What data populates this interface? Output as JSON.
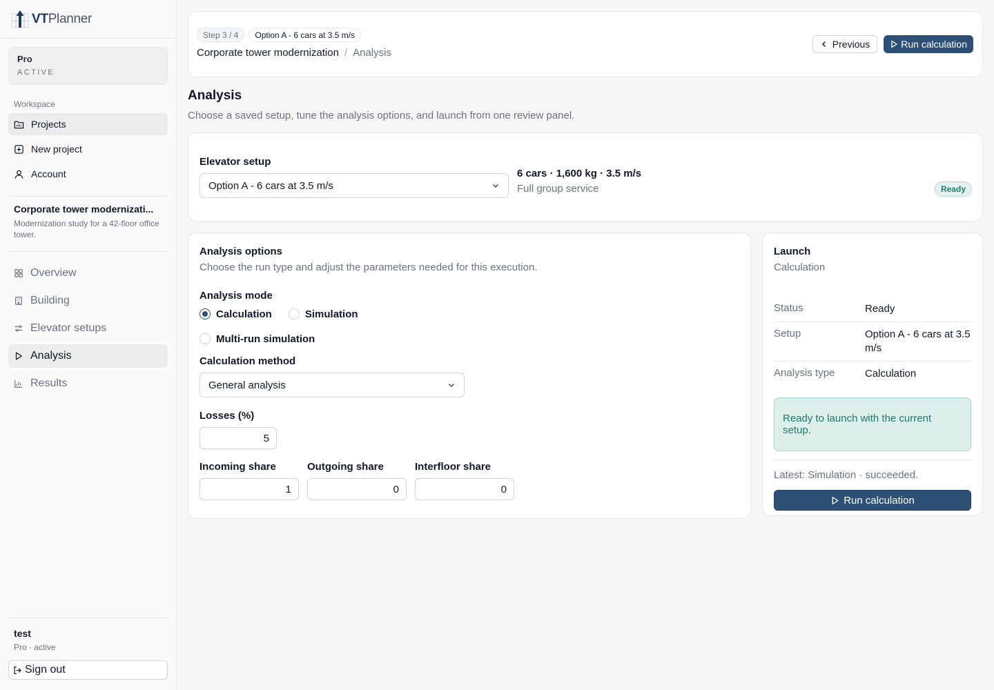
{
  "brand": {
    "vt": "VT",
    "planner": "Planner"
  },
  "plan": {
    "name": "Pro",
    "status": "ACTIVE"
  },
  "workspace": {
    "title": "Workspace",
    "items": [
      {
        "label": "Projects",
        "icon": "folder-icon",
        "active": true
      },
      {
        "label": "New project",
        "icon": "plus-square-icon",
        "active": false
      },
      {
        "label": "Account",
        "icon": "user-icon",
        "active": false
      }
    ]
  },
  "project": {
    "title": "Corporate tower modernizati...",
    "description": "Modernization study for a 42-floor office tower.",
    "nav": [
      {
        "label": "Overview",
        "icon": "grid-icon",
        "active": false
      },
      {
        "label": "Building",
        "icon": "building-icon",
        "active": false
      },
      {
        "label": "Elevator setups",
        "icon": "sliders-icon",
        "active": false
      },
      {
        "label": "Analysis",
        "icon": "play-icon",
        "active": true
      },
      {
        "label": "Results",
        "icon": "bar-chart-icon",
        "active": false
      }
    ]
  },
  "user": {
    "name": "test",
    "plan": "Pro · active",
    "signout": "Sign out"
  },
  "header": {
    "step": "Step 3 / 4",
    "option_chip": "Option A - 6 cars at 3.5 m/s",
    "breadcrumb_project": "Corporate tower modernization",
    "breadcrumb_sep": "/",
    "breadcrumb_current": "Analysis",
    "previous_label": "Previous",
    "run_label": "Run calculation"
  },
  "page": {
    "title": "Analysis",
    "subtitle": "Choose a saved setup, tune the analysis options, and launch from one review panel."
  },
  "setup": {
    "label": "Elevator setup",
    "selected": "Option A - 6 cars at 3.5 m/s",
    "spec": "6 cars · 1,600 kg · 3.5 m/s",
    "service": "Full group service",
    "badge": "Ready"
  },
  "options": {
    "title": "Analysis options",
    "subtitle": "Choose the run type and adjust the parameters needed for this execution.",
    "mode_label": "Analysis mode",
    "modes": [
      {
        "label": "Calculation",
        "selected": true
      },
      {
        "label": "Simulation",
        "selected": false
      },
      {
        "label": "Multi-run simulation",
        "selected": false
      }
    ],
    "method_label": "Calculation method",
    "method_selected": "General analysis",
    "losses_label": "Losses (%)",
    "losses_value": "5",
    "shares": [
      {
        "label": "Incoming share",
        "value": "1"
      },
      {
        "label": "Outgoing share",
        "value": "0"
      },
      {
        "label": "Interfloor share",
        "value": "0"
      }
    ]
  },
  "launch": {
    "title": "Launch",
    "subtitle": "Calculation",
    "rows": [
      {
        "key": "Status",
        "value": "Ready"
      },
      {
        "key": "Setup",
        "value": "Option A - 6 cars at 3.5 m/s"
      },
      {
        "key": "Analysis type",
        "value": "Calculation"
      }
    ],
    "notice": "Ready to launch with the current setup.",
    "latest": "Latest: Simulation · succeeded.",
    "run_label": "Run calculation"
  },
  "colors": {
    "primary": "#2d5077",
    "success_bg": "#dcefeb",
    "success_text": "#1f7a66"
  }
}
